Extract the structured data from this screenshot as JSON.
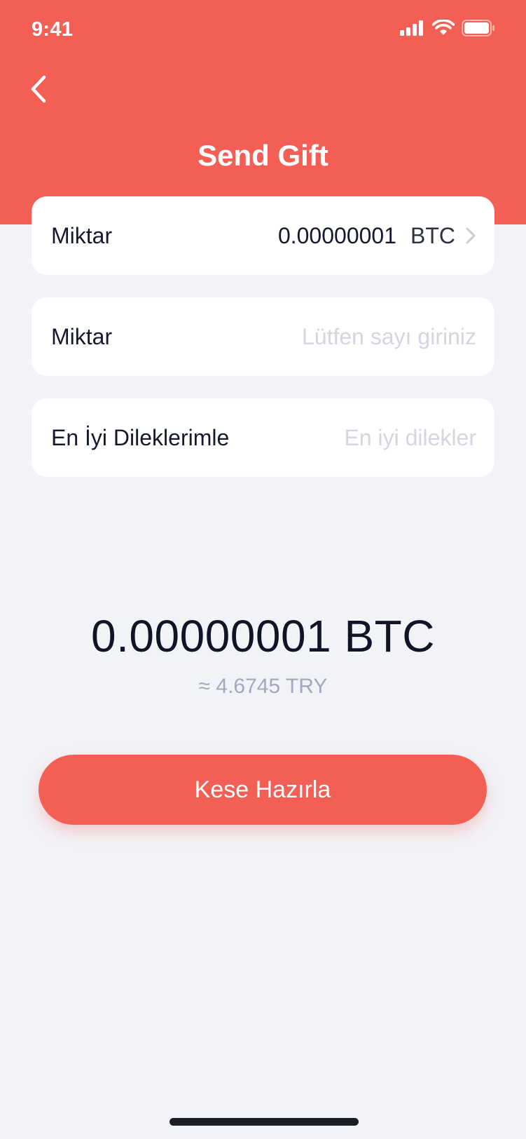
{
  "status_bar": {
    "time": "9:41",
    "icons": [
      "signal-icon",
      "wifi-icon",
      "battery-icon"
    ]
  },
  "header": {
    "title": "Send Gift",
    "back_icon": "chevron-left-icon"
  },
  "form": {
    "coin_row": {
      "label": "Miktar",
      "value": "0.00000001",
      "unit": "BTC",
      "chevron_icon": "chevron-right-icon"
    },
    "amount_row": {
      "label": "Miktar",
      "value": "",
      "placeholder": "Lütfen sayı giriniz"
    },
    "wishes_row": {
      "label": "En İyi Dileklerimle",
      "value": "",
      "placeholder": "En iyi dilekler"
    }
  },
  "summary": {
    "amount": "0.00000001 BTC",
    "fiat_estimate": "≈ 4.6745 TRY"
  },
  "actions": {
    "primary_label": "Kese Hazırla"
  },
  "colors": {
    "accent": "#f35f54",
    "background": "#f2f3f7",
    "card": "#ffffff",
    "text_primary": "#141a2e",
    "text_muted": "#a2a8bd",
    "placeholder": "#d3d6e2"
  }
}
